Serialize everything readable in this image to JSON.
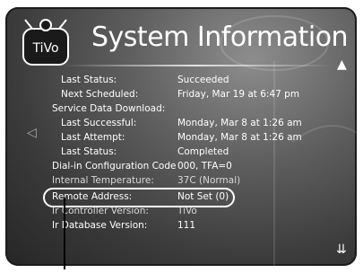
{
  "header": {
    "title": "System Information",
    "logo_text": "TiVo"
  },
  "rows": [
    {
      "label": "Last Status:",
      "value": "Succeeded",
      "indent": true
    },
    {
      "label": "Next Scheduled:",
      "value": "Friday, Mar 19 at 6:47 pm",
      "indent": true
    },
    {
      "label": "Service Data Download:",
      "value": "",
      "indent": false
    },
    {
      "label": "Last Successful:",
      "value": "Monday, Mar 8 at 1:26 am",
      "indent": true
    },
    {
      "label": "Last Attempt:",
      "value": "Monday, Mar 8 at 1:26 am",
      "indent": true
    },
    {
      "label": "Last Status:",
      "value": "Completed",
      "indent": true
    },
    {
      "label": "Dial-in Configuration Code",
      "value": "000, TFA=0",
      "indent": false
    },
    {
      "label": "Internal Temperature:",
      "value": "37C (Normal)",
      "indent": false
    },
    {
      "label": "Remote Address:",
      "value": "Not Set (0)",
      "indent": false
    },
    {
      "label": "Ir Controller Version:",
      "value": "TiVo",
      "indent": false
    },
    {
      "label": "Ir Database Version:",
      "value": "111",
      "indent": false
    }
  ],
  "nav": {
    "scroll_up": "▲",
    "scroll_down": "⇊",
    "left": "◁"
  }
}
